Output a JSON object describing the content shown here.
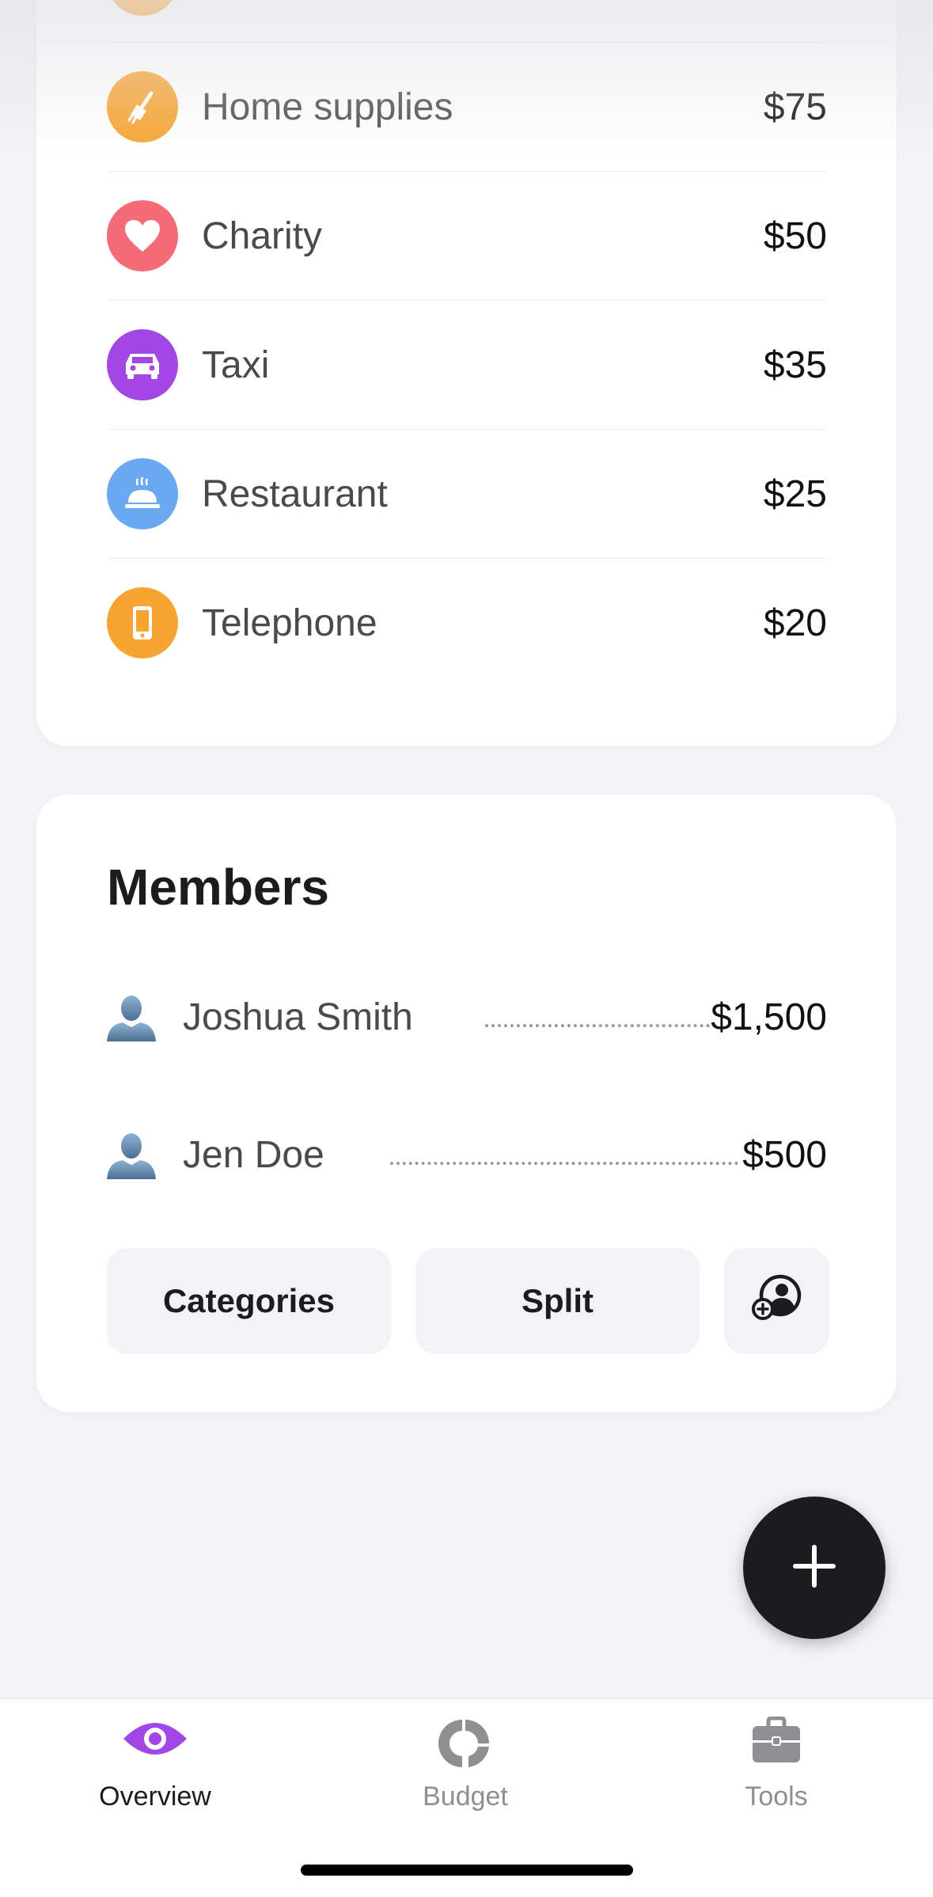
{
  "categories": [
    {
      "label": "Home supplies",
      "amount": "$75",
      "icon": "broom-icon",
      "color": "#f7a531"
    },
    {
      "label": "Charity",
      "amount": "$50",
      "icon": "heart-icon",
      "color": "#f26b76"
    },
    {
      "label": "Taxi",
      "amount": "$35",
      "icon": "car-icon",
      "color": "#a246e6"
    },
    {
      "label": "Restaurant",
      "amount": "$25",
      "icon": "cloche-icon",
      "color": "#6aa9ef"
    },
    {
      "label": "Telephone",
      "amount": "$20",
      "icon": "phone-icon",
      "color": "#f7a531"
    }
  ],
  "members": {
    "title": "Members",
    "people": [
      {
        "name": "Joshua Smith",
        "amount": "$1,500"
      },
      {
        "name": "Jen Doe",
        "amount": "$500"
      }
    ],
    "buttons": {
      "categories_label": "Categories",
      "split_label": "Split",
      "add_member_icon": "add-person-icon"
    }
  },
  "fab": {
    "icon": "plus-icon"
  },
  "tabbar": {
    "tabs": [
      {
        "label": "Overview",
        "icon": "eye-icon",
        "active": true,
        "color": "#a246e6"
      },
      {
        "label": "Budget",
        "icon": "donut-chart-icon",
        "active": false,
        "color": "#8e8e93"
      },
      {
        "label": "Tools",
        "icon": "briefcase-icon",
        "active": false,
        "color": "#8e8e93"
      }
    ]
  },
  "colors": {
    "background": "#f2f2f7",
    "card": "#ffffff",
    "accent": "#a246e6",
    "fab": "#1c1c1e"
  }
}
